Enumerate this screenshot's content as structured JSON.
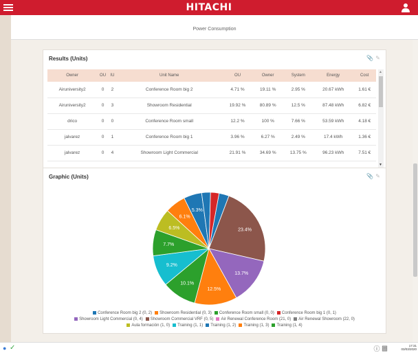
{
  "app": {
    "brand": "HITACHI",
    "subtitle": "Power Consumption"
  },
  "results": {
    "title": "Results (Units)",
    "columns": [
      "Owner",
      "OU",
      "IU",
      "Unit Name",
      "OU",
      "Owner",
      "System",
      "Energy",
      "Cost"
    ],
    "rows": [
      [
        "Airuniversity2",
        "0",
        "2",
        "Conference Room big 2",
        "4.71 %",
        "19.11 %",
        "2.95 %",
        "20.67 kWh",
        "1.61 €"
      ],
      [
        "Airuniversity2",
        "0",
        "3",
        "Showroom Residential",
        "19.92 %",
        "80.89 %",
        "12.5 %",
        "87.48 kWh",
        "6.82 €"
      ],
      [
        "drico",
        "0",
        "0",
        "Conference Room small",
        "12.2 %",
        "100 %",
        "7.66 %",
        "53.59 kWh",
        "4.18 €"
      ],
      [
        "jalvarez",
        "0",
        "1",
        "Conference Room big 1",
        "3.96 %",
        "6.27 %",
        "2.49 %",
        "17.4 kWh",
        "1.36 €"
      ],
      [
        "jalvarez",
        "0",
        "4",
        "Showroom Light Commercial",
        "21.91 %",
        "34.69 %",
        "13.75 %",
        "96.23 kWh",
        "7.51 €"
      ]
    ]
  },
  "graphic": {
    "title": "Graphic (Units)"
  },
  "chart_data": {
    "type": "pie",
    "slices": [
      {
        "label": "Conference Room big 2 (0, 2)",
        "value": 2.95,
        "color": "#1f77b4",
        "text": ""
      },
      {
        "label": "Showroom Light Commercial (0, 4)",
        "value": 23.4,
        "color": "#8c564b",
        "text": "23.4%"
      },
      {
        "label": "Aula formación (1, 0)",
        "value": 13.7,
        "color": "#9467bd",
        "text": "13.7%"
      },
      {
        "label": "Training (1, 3)",
        "value": 12.5,
        "color": "#ff7f0e",
        "text": "12.5%"
      },
      {
        "label": "Training (1, 4)",
        "value": 10.1,
        "color": "#2ca02c",
        "text": "10.1%"
      },
      {
        "label": "Training (1, 1)",
        "value": 9.2,
        "color": "#17becf",
        "text": "9.2%"
      },
      {
        "label": "Conference Room small (0, 0)",
        "value": 7.7,
        "color": "#2ca02c",
        "text": "7.7%"
      },
      {
        "label": "Aula formación (1, 0)",
        "value": 6.5,
        "color": "#bcbd22",
        "text": "6.5%"
      },
      {
        "label": "Showroom Residential (0, 3)",
        "value": 6.1,
        "color": "#ff7f0e",
        "text": "6.1%"
      },
      {
        "label": "Training (1, 2)",
        "value": 5.3,
        "color": "#1f77b4",
        "text": "5.3%"
      },
      {
        "label": "Conference Room big 2 (0, 2)",
        "value": 2.6,
        "color": "#1f77b4",
        "text": ""
      },
      {
        "label": "Conference Room big 1 (0, 1)",
        "value": 2.5,
        "color": "#d62728",
        "text": ""
      }
    ],
    "legend": [
      {
        "label": "Conference Room big 2 (0, 2)",
        "color": "#1f77b4"
      },
      {
        "label": "Showroom Residential (0, 3)",
        "color": "#ff7f0e"
      },
      {
        "label": "Conference Room small (0, 0)",
        "color": "#2ca02c"
      },
      {
        "label": "Conference Room big 1 (0, 1)",
        "color": "#d62728"
      },
      {
        "label": "Showroom Light Commercial (0, 4)",
        "color": "#9467bd"
      },
      {
        "label": "Showroom Commercial VRF (0, 5)",
        "color": "#8c564b"
      },
      {
        "label": "Air Renewal Conference Room (21, 0)",
        "color": "#e377c2"
      },
      {
        "label": "Air Renewal Showroom (22, 0)",
        "color": "#7f7f7f"
      },
      {
        "label": "Aula formación (1, 0)",
        "color": "#bcbd22"
      },
      {
        "label": "Training (1, 1)",
        "color": "#17becf"
      },
      {
        "label": "Training (1, 2)",
        "color": "#1f77b4"
      },
      {
        "label": "Training (1, 3)",
        "color": "#ff7f0e"
      },
      {
        "label": "Training (1, 4)",
        "color": "#2ca02c"
      }
    ]
  },
  "status": {
    "time": "17:31",
    "date": "03/03/2020"
  }
}
